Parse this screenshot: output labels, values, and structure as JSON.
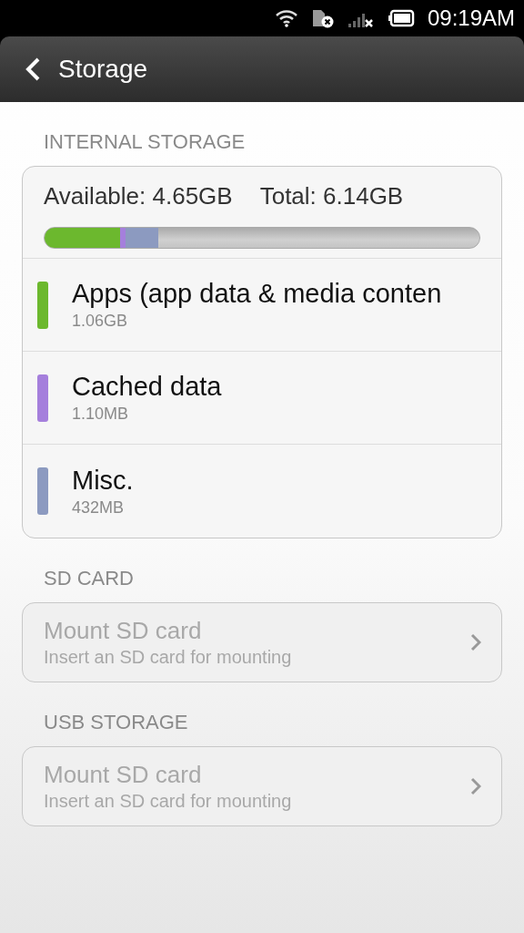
{
  "status_bar": {
    "time": "09:19AM"
  },
  "header": {
    "title": "Storage"
  },
  "internal": {
    "heading": "INTERNAL STORAGE",
    "available": "Available: 4.65GB",
    "total": "Total: 6.14GB",
    "categories": [
      {
        "name": "Apps (app data & media conten",
        "size": "1.06GB",
        "color": "#6cb82e"
      },
      {
        "name": "Cached data",
        "size": "1.10MB",
        "color": "#a57fdc"
      },
      {
        "name": "Misc.",
        "size": "432MB",
        "color": "#8c9ac0"
      }
    ]
  },
  "sections": [
    {
      "heading": "SD CARD",
      "title": "Mount SD card",
      "subtitle": "Insert an SD card for mounting",
      "disabled": true
    },
    {
      "heading": "USB STORAGE",
      "title": "Mount SD card",
      "subtitle": "Insert an SD card for mounting",
      "disabled": true
    }
  ]
}
